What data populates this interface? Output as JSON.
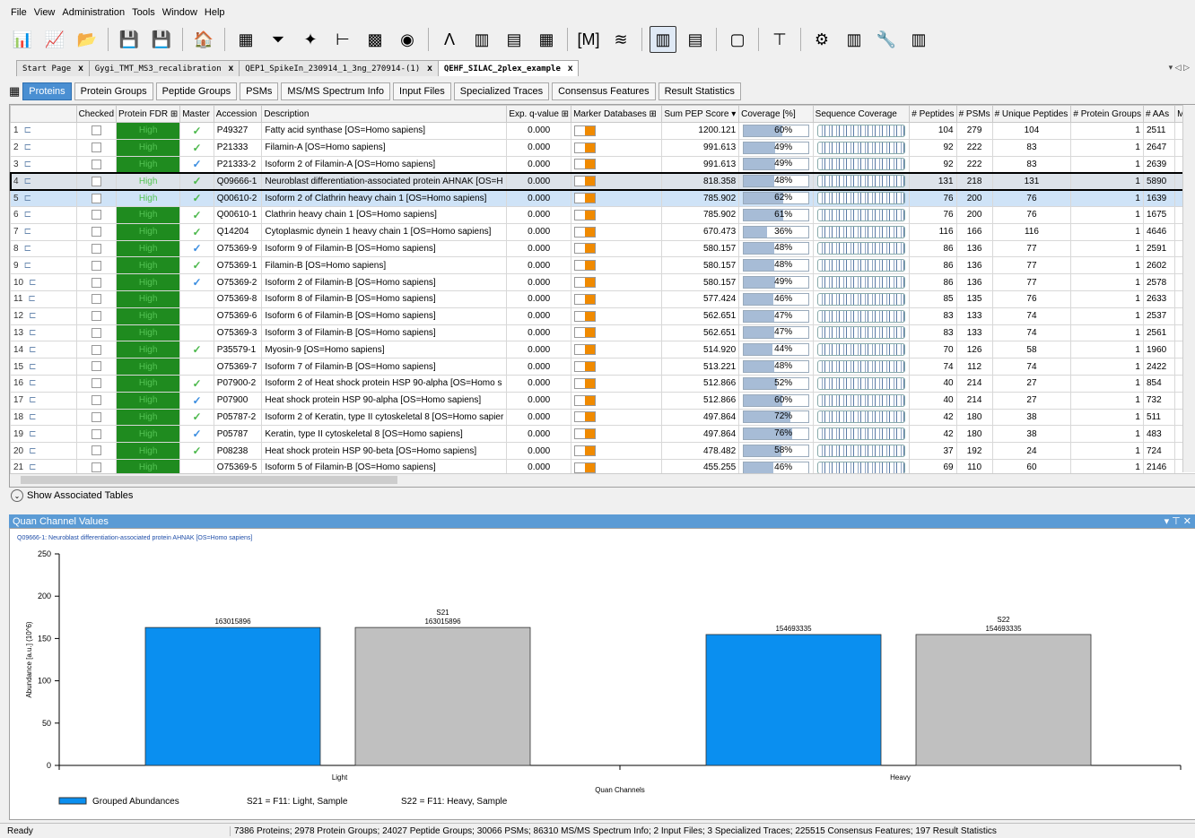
{
  "menu": [
    "File",
    "View",
    "Administration",
    "Tools",
    "Window",
    "Help"
  ],
  "toolbar": {
    "icons": [
      "open-study-icon",
      "open-result-icon",
      "folder-icon",
      "save-icon",
      "save-all-icon",
      "home-icon",
      "table-icon",
      "filter-icon",
      "chart-icon",
      "tree-icon",
      "heatmap-icon",
      "eye-icon",
      "spectrum-icon",
      "bar-chart-icon",
      "bar-chart-2-icon",
      "grid-icon",
      "sequence-icon",
      "line-chart-icon",
      "quan-icon",
      "quan-2-icon",
      "document-icon",
      "hierarchy-icon",
      "settings-icon",
      "database-icon",
      "export-icon",
      "database-2-icon"
    ],
    "glyphs": [
      "📊",
      "📈",
      "📂",
      "💾",
      "💾",
      "🏠",
      "▦",
      "⏷",
      "✦",
      "⊢",
      "▩",
      "◉",
      "Λ",
      "▥",
      "▤",
      "▦",
      "[M]",
      "≋",
      "▥",
      "▤",
      "▢",
      "⊤",
      "⚙",
      "▥",
      "🔧",
      "▥"
    ],
    "active_index": 18
  },
  "file_tabs": [
    {
      "label": "Start Page",
      "close": "x",
      "active": false
    },
    {
      "label": "Gygi_TMT_MS3_recalibration",
      "close": "x",
      "active": false
    },
    {
      "label": "QEP1_SpikeIn_230914_1_3ng_270914-(1)",
      "close": "x",
      "active": false
    },
    {
      "label": "QEHF_SILAC_2plex_example",
      "close": "x",
      "active": true
    }
  ],
  "tabs_right": "▾ ◁ ▷",
  "sub_tabs": [
    {
      "label": "Proteins",
      "active": true
    },
    {
      "label": "Protein Groups",
      "active": false
    },
    {
      "label": "Peptide Groups",
      "active": false
    },
    {
      "label": "PSMs",
      "active": false
    },
    {
      "label": "MS/MS Spectrum Info",
      "active": false
    },
    {
      "label": "Input Files",
      "active": false
    },
    {
      "label": "Specialized Traces",
      "active": false
    },
    {
      "label": "Consensus Features",
      "active": false
    },
    {
      "label": "Result Statistics",
      "active": false
    }
  ],
  "columns": [
    "",
    "Checked",
    "Protein FDR ⊞",
    "Master",
    "Accession",
    "Description",
    "Exp. q-value ⊞",
    "Marker Databases ⊞",
    "Sum PEP Score ▾",
    "Coverage [%]",
    "Sequence Coverage",
    "# Peptides",
    "# PSMs",
    "# Unique Peptides",
    "# Protein Groups",
    "# AAs",
    "MW"
  ],
  "rows": [
    {
      "n": "1",
      "fdr": "High",
      "master": "g",
      "acc": "P49327",
      "desc": "Fatty acid synthase [OS=Homo sapiens]",
      "q": "0.000",
      "score": "1200.121",
      "cov": "60%",
      "covv": 60,
      "pep": "104",
      "psm": "279",
      "uniq": "104",
      "pg": "1",
      "aas": "2511"
    },
    {
      "n": "2",
      "fdr": "High",
      "master": "g",
      "acc": "P21333",
      "desc": "Filamin-A [OS=Homo sapiens]",
      "q": "0.000",
      "score": "991.613",
      "cov": "49%",
      "covv": 49,
      "pep": "92",
      "psm": "222",
      "uniq": "83",
      "pg": "1",
      "aas": "2647"
    },
    {
      "n": "3",
      "fdr": "High",
      "master": "b",
      "acc": "P21333-2",
      "desc": "Isoform 2 of Filamin-A [OS=Homo sapiens]",
      "q": "0.000",
      "score": "991.613",
      "cov": "49%",
      "covv": 49,
      "pep": "92",
      "psm": "222",
      "uniq": "83",
      "pg": "1",
      "aas": "2639"
    },
    {
      "n": "4",
      "fdr": "High",
      "master": "g",
      "acc": "Q09666-1",
      "desc": "Neuroblast differentiation-associated protein AHNAK [OS=H",
      "q": "0.000",
      "score": "818.358",
      "cov": "48%",
      "covv": 48,
      "pep": "131",
      "psm": "218",
      "uniq": "131",
      "pg": "1",
      "aas": "5890",
      "state": "cur"
    },
    {
      "n": "5",
      "fdr": "High",
      "master": "g",
      "acc": "Q00610-2",
      "desc": "Isoform 2 of Clathrin heavy chain 1 [OS=Homo sapiens]",
      "q": "0.000",
      "score": "785.902",
      "cov": "62%",
      "covv": 62,
      "pep": "76",
      "psm": "200",
      "uniq": "76",
      "pg": "1",
      "aas": "1639",
      "state": "sel"
    },
    {
      "n": "6",
      "fdr": "High",
      "master": "g",
      "acc": "Q00610-1",
      "desc": "Clathrin heavy chain 1 [OS=Homo sapiens]",
      "q": "0.000",
      "score": "785.902",
      "cov": "61%",
      "covv": 61,
      "pep": "76",
      "psm": "200",
      "uniq": "76",
      "pg": "1",
      "aas": "1675"
    },
    {
      "n": "7",
      "fdr": "High",
      "master": "g",
      "acc": "Q14204",
      "desc": "Cytoplasmic dynein 1 heavy chain 1 [OS=Homo sapiens]",
      "q": "0.000",
      "score": "670.473",
      "cov": "36%",
      "covv": 36,
      "pep": "116",
      "psm": "166",
      "uniq": "116",
      "pg": "1",
      "aas": "4646"
    },
    {
      "n": "8",
      "fdr": "High",
      "master": "b",
      "acc": "O75369-9",
      "desc": "Isoform 9 of Filamin-B [OS=Homo sapiens]",
      "q": "0.000",
      "score": "580.157",
      "cov": "48%",
      "covv": 48,
      "pep": "86",
      "psm": "136",
      "uniq": "77",
      "pg": "1",
      "aas": "2591"
    },
    {
      "n": "9",
      "fdr": "High",
      "master": "g",
      "acc": "O75369-1",
      "desc": "Filamin-B [OS=Homo sapiens]",
      "q": "0.000",
      "score": "580.157",
      "cov": "48%",
      "covv": 48,
      "pep": "86",
      "psm": "136",
      "uniq": "77",
      "pg": "1",
      "aas": "2602"
    },
    {
      "n": "10",
      "fdr": "High",
      "master": "b",
      "acc": "O75369-2",
      "desc": "Isoform 2 of Filamin-B [OS=Homo sapiens]",
      "q": "0.000",
      "score": "580.157",
      "cov": "49%",
      "covv": 49,
      "pep": "86",
      "psm": "136",
      "uniq": "77",
      "pg": "1",
      "aas": "2578"
    },
    {
      "n": "11",
      "fdr": "High",
      "master": "",
      "acc": "O75369-8",
      "desc": "Isoform 8 of Filamin-B [OS=Homo sapiens]",
      "q": "0.000",
      "score": "577.424",
      "cov": "46%",
      "covv": 46,
      "pep": "85",
      "psm": "135",
      "uniq": "76",
      "pg": "1",
      "aas": "2633"
    },
    {
      "n": "12",
      "fdr": "High",
      "master": "",
      "acc": "O75369-6",
      "desc": "Isoform 6 of Filamin-B [OS=Homo sapiens]",
      "q": "0.000",
      "score": "562.651",
      "cov": "47%",
      "covv": 47,
      "pep": "83",
      "psm": "133",
      "uniq": "74",
      "pg": "1",
      "aas": "2537"
    },
    {
      "n": "13",
      "fdr": "High",
      "master": "",
      "acc": "O75369-3",
      "desc": "Isoform 3 of Filamin-B [OS=Homo sapiens]",
      "q": "0.000",
      "score": "562.651",
      "cov": "47%",
      "covv": 47,
      "pep": "83",
      "psm": "133",
      "uniq": "74",
      "pg": "1",
      "aas": "2561"
    },
    {
      "n": "14",
      "fdr": "High",
      "master": "g",
      "acc": "P35579-1",
      "desc": "Myosin-9 [OS=Homo sapiens]",
      "q": "0.000",
      "score": "514.920",
      "cov": "44%",
      "covv": 44,
      "pep": "70",
      "psm": "126",
      "uniq": "58",
      "pg": "1",
      "aas": "1960"
    },
    {
      "n": "15",
      "fdr": "High",
      "master": "",
      "acc": "O75369-7",
      "desc": "Isoform 7 of Filamin-B [OS=Homo sapiens]",
      "q": "0.000",
      "score": "513.221",
      "cov": "48%",
      "covv": 48,
      "pep": "74",
      "psm": "112",
      "uniq": "74",
      "pg": "1",
      "aas": "2422"
    },
    {
      "n": "16",
      "fdr": "High",
      "master": "g",
      "acc": "P07900-2",
      "desc": "Isoform 2 of Heat shock protein HSP 90-alpha [OS=Homo s",
      "q": "0.000",
      "score": "512.866",
      "cov": "52%",
      "covv": 52,
      "pep": "40",
      "psm": "214",
      "uniq": "27",
      "pg": "1",
      "aas": "854"
    },
    {
      "n": "17",
      "fdr": "High",
      "master": "b",
      "acc": "P07900",
      "desc": "Heat shock protein HSP 90-alpha [OS=Homo sapiens]",
      "q": "0.000",
      "score": "512.866",
      "cov": "60%",
      "covv": 60,
      "pep": "40",
      "psm": "214",
      "uniq": "27",
      "pg": "1",
      "aas": "732"
    },
    {
      "n": "18",
      "fdr": "High",
      "master": "g",
      "acc": "P05787-2",
      "desc": "Isoform 2 of Keratin, type II cytoskeletal 8 [OS=Homo sapier",
      "q": "0.000",
      "score": "497.864",
      "cov": "72%",
      "covv": 72,
      "pep": "42",
      "psm": "180",
      "uniq": "38",
      "pg": "1",
      "aas": "511"
    },
    {
      "n": "19",
      "fdr": "High",
      "master": "b",
      "acc": "P05787",
      "desc": "Keratin, type II cytoskeletal 8 [OS=Homo sapiens]",
      "q": "0.000",
      "score": "497.864",
      "cov": "76%",
      "covv": 76,
      "pep": "42",
      "psm": "180",
      "uniq": "38",
      "pg": "1",
      "aas": "483"
    },
    {
      "n": "20",
      "fdr": "High",
      "master": "g",
      "acc": "P08238",
      "desc": "Heat shock protein HSP 90-beta [OS=Homo sapiens]",
      "q": "0.000",
      "score": "478.482",
      "cov": "58%",
      "covv": 58,
      "pep": "37",
      "psm": "192",
      "uniq": "24",
      "pg": "1",
      "aas": "724"
    },
    {
      "n": "21",
      "fdr": "High",
      "master": "",
      "acc": "O75369-5",
      "desc": "Isoform 5 of Filamin-B [OS=Homo sapiens]",
      "q": "0.000",
      "score": "455.255",
      "cov": "46%",
      "covv": 46,
      "pep": "69",
      "psm": "110",
      "uniq": "60",
      "pg": "1",
      "aas": "2146"
    }
  ],
  "show_associated": "Show Associated Tables",
  "quan_panel": {
    "title": "Quan Channel Values",
    "controls": "▾ ⊤ ✕"
  },
  "chart_data": {
    "type": "bar",
    "title": "Q09666-1: Neuroblast differentiation-associated protein AHNAK [OS=Homo sapiens]",
    "xlabel": "Quan Channels",
    "ylabel": "Abundance [a.u.] (10^6)",
    "ylim": [
      0,
      250
    ],
    "yticks": [
      0,
      50,
      100,
      150,
      200,
      250
    ],
    "categories": [
      "Light",
      "Heavy"
    ],
    "series": [
      {
        "name": "Grouped Abundances",
        "color": "#0a8ff0",
        "values": [
          163.015896,
          154.693335
        ],
        "labels": [
          "163015896",
          "154693335"
        ]
      },
      {
        "name": "S21 = F11: Light, Sample",
        "color": "#c0c0c0",
        "values": [
          163.015896,
          null
        ],
        "labels": [
          "S21\n163015896",
          ""
        ]
      },
      {
        "name": "S22 = F11: Heavy, Sample",
        "color": "#c0c0c0",
        "values": [
          null,
          154.693335
        ],
        "labels": [
          "",
          "S22\n154693335"
        ]
      }
    ],
    "legend": [
      "Grouped Abundances",
      "S21 = F11: Light, Sample",
      "S22 = F11: Heavy, Sample"
    ],
    "legend_position": "bottom"
  },
  "status": {
    "ready": "Ready",
    "info": "7386 Proteins; 2978 Protein Groups; 24027 Peptide Groups; 30066 PSMs; 86310 MS/MS Spectrum Info; 2 Input Files; 3 Specialized Traces; 225515 Consensus Features; 197 Result Statistics"
  }
}
